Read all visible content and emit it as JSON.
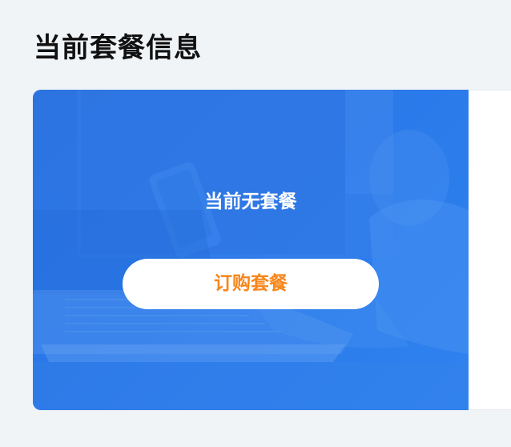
{
  "section": {
    "title": "当前套餐信息"
  },
  "plan_card": {
    "empty_text": "当前无套餐",
    "order_button_label": "订购套餐"
  },
  "colors": {
    "page_background": "#f1f4f7",
    "card_blue": "#2a79ea",
    "button_text_orange": "#f7861b",
    "button_background": "#ffffff"
  }
}
